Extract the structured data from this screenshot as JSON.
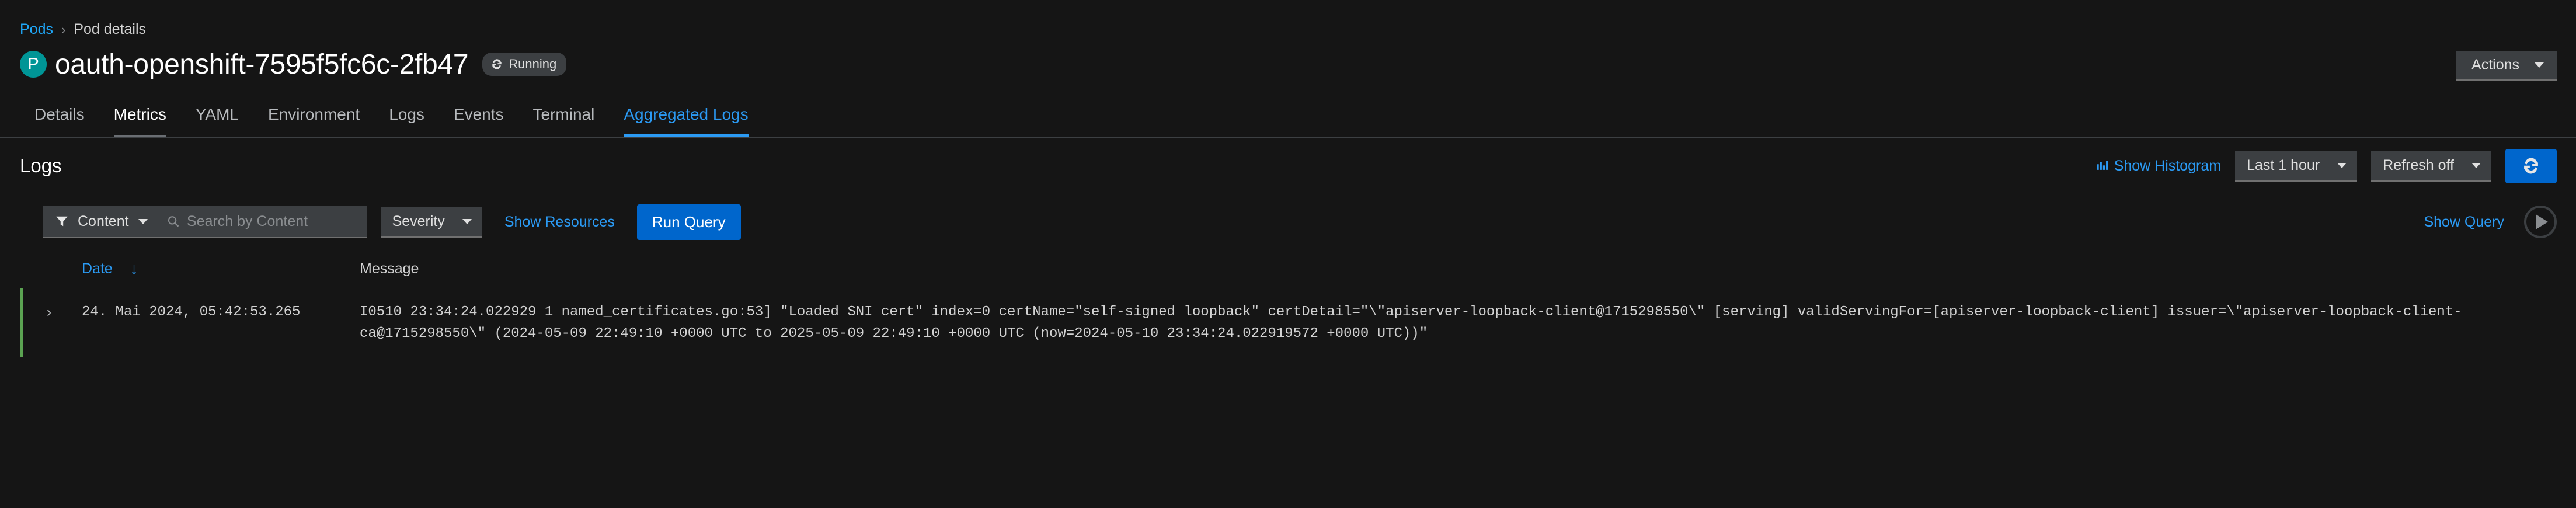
{
  "breadcrumb": {
    "parent": "Pods",
    "separator": "›",
    "current": "Pod details"
  },
  "header": {
    "pod_initial": "P",
    "title": "oauth-openshift-7595f5fc6c-2fb47",
    "status": "Running",
    "status_icon": "sync-icon",
    "actions_label": "Actions",
    "actions_caret_icon": "caret-down-icon",
    "accent_blue": "#2b9af3",
    "pod_badge_color": "#009596",
    "status_running_color": "#3c3f42"
  },
  "tabs": [
    {
      "label": "Details",
      "state": "default"
    },
    {
      "label": "Metrics",
      "state": "hovered"
    },
    {
      "label": "YAML",
      "state": "default"
    },
    {
      "label": "Environment",
      "state": "default"
    },
    {
      "label": "Logs",
      "state": "default"
    },
    {
      "label": "Events",
      "state": "default"
    },
    {
      "label": "Terminal",
      "state": "default"
    },
    {
      "label": "Aggregated Logs",
      "state": "active"
    }
  ],
  "logs_section": {
    "title": "Logs",
    "show_histogram_label": "Show Histogram",
    "show_histogram_icon": "histogram-icon",
    "time_range": "Last 1 hour",
    "refresh_interval": "Refresh off",
    "refresh_button_icon": "sync-icon",
    "refresh_button_color": "#0066cc"
  },
  "query_bar": {
    "filter_type": "Content",
    "filter_icon": "filter-icon",
    "search_icon": "search-icon",
    "search_value": "",
    "search_placeholder": "Search by Content",
    "severity_label": "Severity",
    "show_resources_label": "Show Resources",
    "run_query_label": "Run Query",
    "show_query_label": "Show Query",
    "play_icon": "play-icon"
  },
  "table": {
    "columns": {
      "date": "Date",
      "sort_icon": "arrow-down-icon",
      "message": "Message"
    },
    "rows": [
      {
        "expand_icon": "chevron-right-icon",
        "severity_color": "#5ba352",
        "date": "24. Mai 2024, 05:42:53.265",
        "message": "I0510 23:34:24.022929 1 named_certificates.go:53] \"Loaded SNI cert\" index=0 certName=\"self-signed loopback\" certDetail=\"\\\"apiserver-loopback-client@1715298550\\\" [serving] validServingFor=[apiserver-loopback-client] issuer=\\\"apiserver-loopback-client-ca@1715298550\\\" (2024-05-09 22:49:10 +0000 UTC to 2025-05-09 22:49:10 +0000 UTC (now=2024-05-10 23:34:24.022919572 +0000 UTC))\""
      }
    ]
  }
}
